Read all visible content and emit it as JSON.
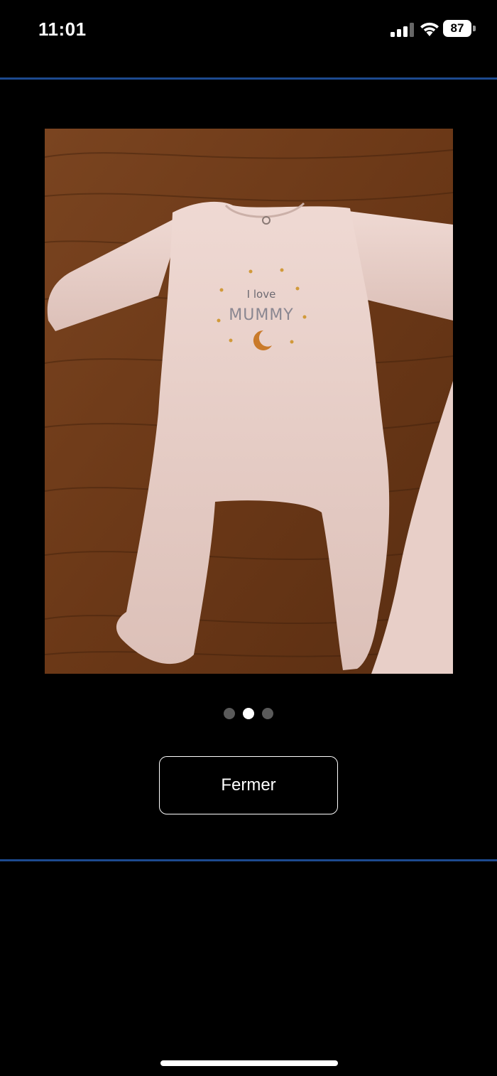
{
  "status_bar": {
    "time": "11:01",
    "battery_level": "87",
    "icons": [
      "signal-icon",
      "wifi-icon",
      "battery-icon"
    ]
  },
  "photo": {
    "subject": "baby-sleepsuit-photo",
    "print_line1": "I love",
    "print_line2": "MUMMY"
  },
  "pagination": {
    "total": 3,
    "current": 2
  },
  "actions": {
    "close_label": "Fermer"
  },
  "colors": {
    "background": "#000000",
    "divider": "#1d4a8f",
    "dot_inactive": "#5a5a5a",
    "dot_active": "#ffffff"
  }
}
